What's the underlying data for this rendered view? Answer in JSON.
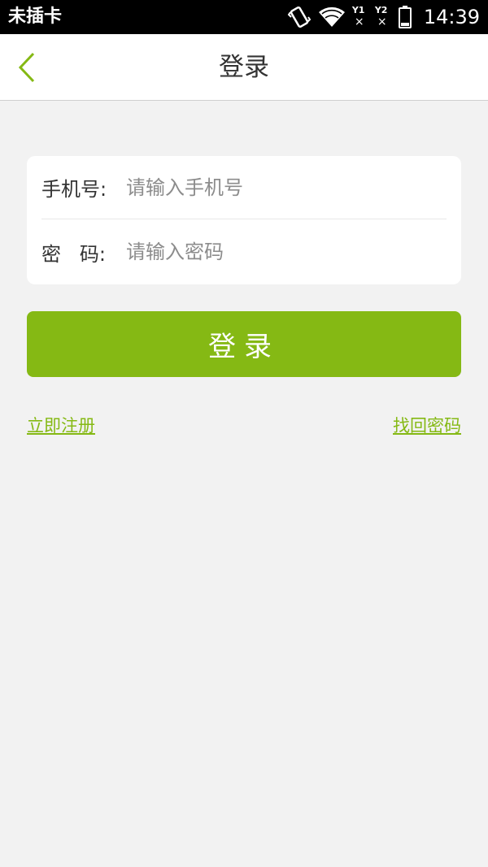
{
  "status_bar": {
    "carrier": "未插卡",
    "sim1_label": "Y1",
    "sim2_label": "Y2",
    "sim_status": "×",
    "time": "14:39",
    "icons": [
      "vibrate-icon",
      "wifi-icon",
      "sim1-no-signal-icon",
      "sim2-no-signal-icon",
      "battery-icon"
    ]
  },
  "nav": {
    "back_icon": "chevron-left-icon",
    "title": "登录"
  },
  "form": {
    "phone_label": "手机号:",
    "phone_placeholder": "请输入手机号",
    "phone_value": "",
    "password_label": "密   码:",
    "password_placeholder": "请输入密码",
    "password_value": ""
  },
  "actions": {
    "login_label": "登录",
    "register_link": "立即注册",
    "forgot_link": "找回密码"
  },
  "colors": {
    "accent": "#85b914",
    "background": "#f2f2f2",
    "status_bar": "#000000"
  }
}
